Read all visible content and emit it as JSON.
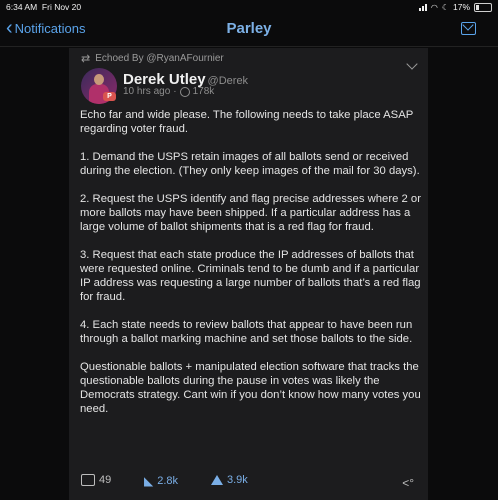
{
  "status": {
    "time": "6:34 AM",
    "date": "Fri Nov 20",
    "battery": "17%"
  },
  "nav": {
    "back_label": "Notifications",
    "title": "Parley",
    "mail_icon": "mail-icon"
  },
  "post": {
    "echoed_by": "Echoed By @RyanAFournier",
    "author_name": "Derek Utley",
    "author_handle": "@Derek",
    "time_ago": "10 hrs ago",
    "views": "178k",
    "badge": "P",
    "paragraphs": [
      "Echo far and wide please. The following needs to take place ASAP regarding voter fraud.",
      "1. Demand the USPS retain images of all ballots send or received during the election. (They only keep images of the mail for 30 days).",
      "2. Request the USPS identify and flag precise addresses where 2 or more ballots may have been shipped. If a particular address has a large volume of ballot shipments that is a red flag for fraud.",
      "3. Request that each state produce the IP addresses of ballots that were requested online. Criminals tend to be dumb and if a particular IP address was requesting a large number of ballots that’s a red flag for fraud.",
      "4. Each state needs to review ballots that appear to have been run through a ballot marking machine and set those ballots to the side.",
      "Questionable ballots + manipulated election software that tracks the questionable ballots during the pause in votes was likely the Democrats strategy. Cant win if you don’t know how many votes you need."
    ],
    "comments": "49",
    "echoes": "2.8k",
    "upvotes": "3.9k"
  }
}
